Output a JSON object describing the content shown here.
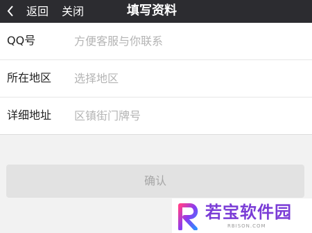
{
  "nav": {
    "back_label": "返回",
    "close_label": "关闭",
    "title": "填写资料"
  },
  "form": {
    "fields": [
      {
        "label": "QQ号",
        "placeholder": "方便客服与你联系",
        "value": ""
      },
      {
        "label": "所在地区",
        "placeholder": "选择地区",
        "value": ""
      },
      {
        "label": "详细地址",
        "placeholder": "区镇街门牌号",
        "value": ""
      }
    ]
  },
  "confirm_label": "确认",
  "watermark": {
    "text": "若宝软件园",
    "sub": "RBISON.COM"
  },
  "colors": {
    "nav_bg": "#2c2c30",
    "page_bg": "#f2f2f2",
    "button_bg": "#e2e2e2",
    "button_text": "#a6a6a6",
    "watermark_purple": "#7a3cd6"
  }
}
